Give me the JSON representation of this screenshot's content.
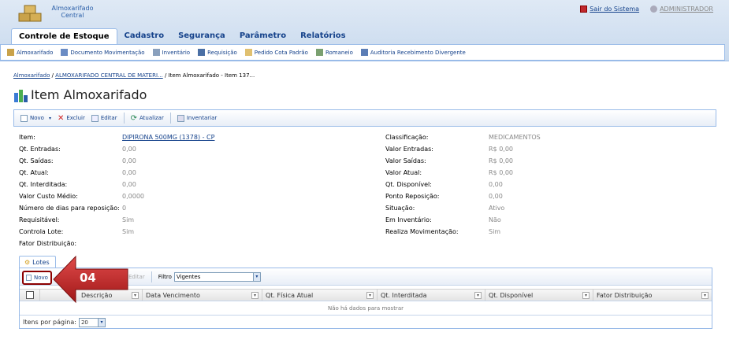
{
  "app": {
    "name_line1": "Almoxarifado",
    "name_line2": "Central"
  },
  "top_links": {
    "logout": "Sair do Sistema",
    "user": "ADMINISTRADOR"
  },
  "menu": [
    {
      "label": "Controle de Estoque"
    },
    {
      "label": "Cadastro"
    },
    {
      "label": "Segurança"
    },
    {
      "label": "Parâmetro"
    },
    {
      "label": "Relatórios"
    }
  ],
  "submenu": [
    {
      "label": "Almoxarifado",
      "icon": "warehouse-icon"
    },
    {
      "label": "Documento Movimentação",
      "icon": "document-icon"
    },
    {
      "label": "Inventário",
      "icon": "inventory-icon"
    },
    {
      "label": "Requisição",
      "icon": "requisition-icon"
    },
    {
      "label": "Pedido Cota Padrão",
      "icon": "order-icon"
    },
    {
      "label": "Romaneio",
      "icon": "arrows-icon"
    },
    {
      "label": "Auditoria Recebimento Divergente",
      "icon": "audit-icon"
    }
  ],
  "breadcrumb": {
    "part1": "Almoxarifado",
    "part2": "ALMOXARIFADO CENTRAL DE MATERI...",
    "part3": "Item Almoxarifado - Item 137..."
  },
  "page": {
    "title": "Item Almoxarifado"
  },
  "toolbar": {
    "novo": "Novo",
    "excluir": "Excluir",
    "editar": "Editar",
    "atualizar": "Atualizar",
    "inventariar": "Inventariar"
  },
  "fields_left": [
    {
      "label": "Item:",
      "value": "DIPIRONA 500MG (1378) - CP"
    },
    {
      "label": "Qt. Entradas:",
      "value": "0,00"
    },
    {
      "label": "Qt. Saídas:",
      "value": "0,00"
    },
    {
      "label": "Qt. Atual:",
      "value": "0,00"
    },
    {
      "label": "Qt. Interditada:",
      "value": "0,00"
    },
    {
      "label": "Valor Custo Médio:",
      "value": "0,0000"
    },
    {
      "label": "Número de dias para reposição:",
      "value": "0"
    },
    {
      "label": "Requisitável:",
      "value": "Sim"
    },
    {
      "label": "Controla Lote:",
      "value": "Sim"
    },
    {
      "label": "Fator Distribuição:",
      "value": ""
    }
  ],
  "fields_right": [
    {
      "label": "Classificação:",
      "value": "MEDICAMENTOS"
    },
    {
      "label": "Valor Entradas:",
      "value": "R$ 0,00"
    },
    {
      "label": "Valor Saídas:",
      "value": "R$ 0,00"
    },
    {
      "label": "Valor Atual:",
      "value": "R$ 0,00"
    },
    {
      "label": "Qt. Disponível:",
      "value": "0,00"
    },
    {
      "label": "Ponto Reposição:",
      "value": "0,00"
    },
    {
      "label": "Situação:",
      "value": "Ativo"
    },
    {
      "label": "Em Inventário:",
      "value": "Não"
    },
    {
      "label": "Realiza Movimentação:",
      "value": "Sim"
    }
  ],
  "lotes": {
    "tab": "Lotes",
    "novo": "Novo",
    "editar": "Editar",
    "filtro_label": "Filtro",
    "filtro_value": "Vigentes",
    "columns": [
      "Descrição",
      "Data Vencimento",
      "Qt. Física Atual",
      "Qt. Interditada",
      "Qt. Disponível",
      "Fator Distribuição"
    ],
    "empty": "Não há dados para mostrar",
    "per_page_label": "Itens por página:",
    "per_page_value": "20"
  },
  "callout": {
    "label": "04",
    "color": "#c0282d"
  }
}
